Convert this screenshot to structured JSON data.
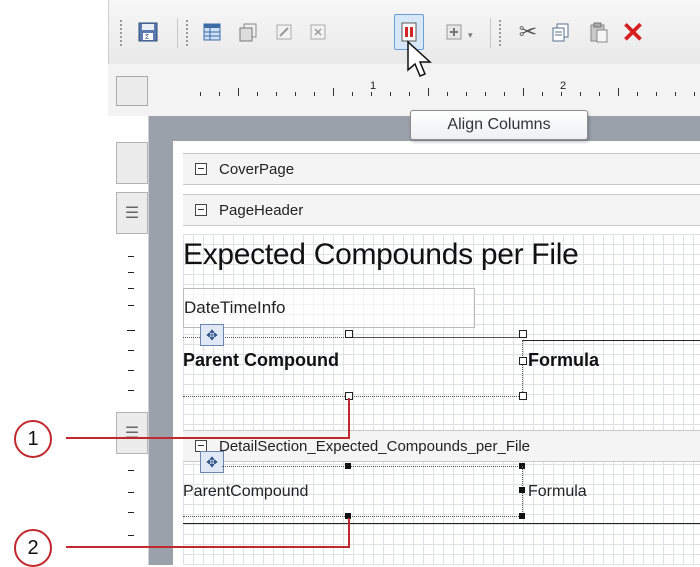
{
  "toolbar": {
    "buttons": [
      "save-icon",
      "table-icon",
      "copy-format-icon",
      "edit-icon",
      "delete-box-icon",
      "align-columns-icon",
      "add-icon",
      "cut-icon",
      "copy-icon",
      "paste-icon",
      "delete-icon"
    ]
  },
  "ruler": {
    "labels": [
      "1",
      "2"
    ]
  },
  "tooltip": {
    "text": "Align Columns"
  },
  "sections": {
    "cover_page": "CoverPage",
    "page_header": "PageHeader",
    "detail": "DetailSection_Expected_Compounds_per_File"
  },
  "report": {
    "title": "Expected Compounds per File",
    "date_time_info": "DateTimeInfo",
    "header_col1": "Parent Compound",
    "header_col2": "Formula",
    "detail_col1": "ParentCompound",
    "detail_col2": "Formula"
  },
  "callouts": [
    "1",
    "2"
  ],
  "colors": {
    "callout": "#c0282d",
    "tooltip_border": "#8c8c8c",
    "active_button": "#d7e8f8"
  }
}
